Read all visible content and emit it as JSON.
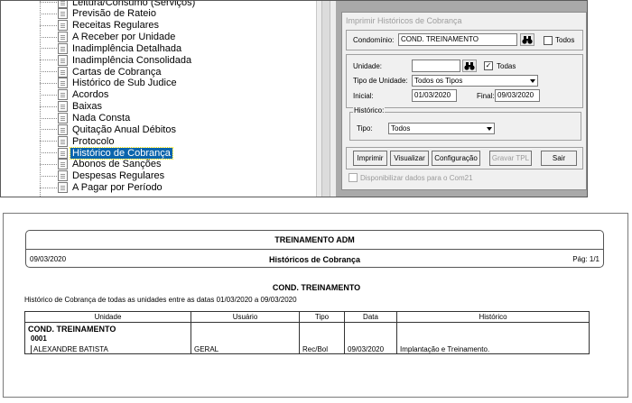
{
  "tree": {
    "items": [
      {
        "label": "Leitura/Consumo (Serviços)",
        "selected": false
      },
      {
        "label": "Previsão de Rateio",
        "selected": false
      },
      {
        "label": "Receitas Regulares",
        "selected": false
      },
      {
        "label": "A Receber por Unidade",
        "selected": false
      },
      {
        "label": "Inadimplência Detalhada",
        "selected": false
      },
      {
        "label": "Inadimplência Consolidada",
        "selected": false
      },
      {
        "label": "Cartas de Cobrança",
        "selected": false
      },
      {
        "label": "Histórico de Sub Judice",
        "selected": false
      },
      {
        "label": "Acordos",
        "selected": false
      },
      {
        "label": "Baixas",
        "selected": false
      },
      {
        "label": "Nada Consta",
        "selected": false
      },
      {
        "label": "Quitação Anual Débitos",
        "selected": false
      },
      {
        "label": "Protocolo",
        "selected": false
      },
      {
        "label": "Histórico de Cobrança",
        "selected": true
      },
      {
        "label": "Abonos de Sanções",
        "selected": false
      },
      {
        "label": "Despesas Regulares",
        "selected": false
      },
      {
        "label": "A Pagar por Período",
        "selected": false
      }
    ]
  },
  "dialog": {
    "title": "Imprimir Históricos de Cobrança",
    "condominio_label": "Condomínio:",
    "condominio_value": "COND. TREINAMENTO",
    "todos_label": "Todos",
    "unidade_label": "Unidade:",
    "unidade_value": "",
    "todas_label": "Todas",
    "todas_checked": "✓",
    "tipo_unidade_label": "Tipo de Unidade:",
    "tipo_unidade_value": "Todos os Tipos",
    "inicial_label": "Inicial:",
    "inicial_value": "01/03/2020",
    "final_label": "Final:",
    "final_value": "09/03/2020",
    "historico_legend": "Histórico:",
    "tipo_label": "Tipo:",
    "tipo_value": "Todos",
    "buttons": {
      "imprimir": "Imprimir",
      "visualizar": "Visualizar",
      "configuracao": "Configuração",
      "gravar_tpl": "Gravar TPL",
      "sair": "Sair"
    },
    "disponibilizar_label": "Disponibilizar dados para o Com21"
  },
  "report": {
    "company": "TREINAMENTO ADM",
    "date": "09/03/2020",
    "title": "Históricos de Cobrança",
    "page": "Pág: 1/1",
    "condo_title": "COND. TREINAMENTO",
    "description": "Histórico de Cobrança de todas as unidades entre as datas 01/03/2020 a 09/03/2020",
    "columns": [
      "Unidade",
      "Usuário",
      "Tipo",
      "Data",
      "Histórico"
    ],
    "group_name": "COND. TREINAMENTO",
    "unit_code": "0001",
    "row": {
      "unidade": "ALEXANDRE BATISTA",
      "usuario": "GERAL",
      "tipo": "Rec/Bol",
      "data": "09/03/2020",
      "historico": "Implantação e Treinamento."
    }
  }
}
